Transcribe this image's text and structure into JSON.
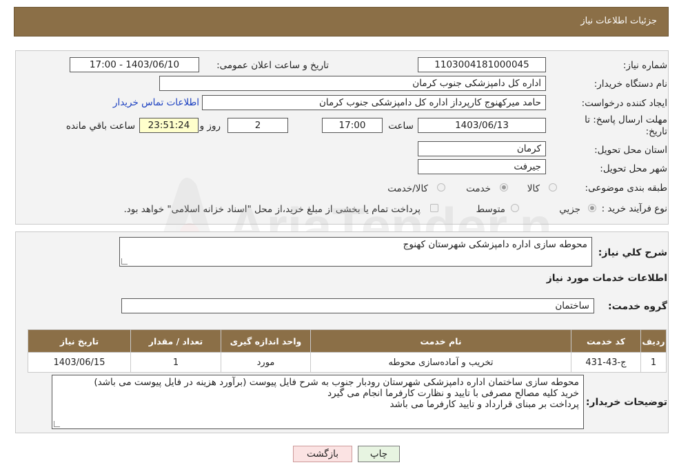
{
  "header": {
    "title": "جزئیات اطلاعات نیاز"
  },
  "form": {
    "need_number_label": "شماره نیاز:",
    "need_number": "1103004181000045",
    "announce_label": "تاریخ و ساعت اعلان عمومی:",
    "announce_value": "1403/06/10 - 17:00",
    "buyer_org_label": "نام دستگاه خریدار:",
    "buyer_org": "اداره کل دامپزشکی جنوب کرمان",
    "creator_label": "ایجاد کننده درخواست:",
    "creator": "حامد میرکهنوج کارپرداز اداره کل دامپزشکی جنوب کرمان",
    "contact_link": "اطلاعات تماس خریدار",
    "deadline_label_line1": "مهلت ارسال پاسخ: تا",
    "deadline_label_line2": "تاریخ:",
    "deadline_date": "1403/06/13",
    "time_label": "ساعت",
    "deadline_time": "17:00",
    "days_value": "2",
    "days_label": "روز و",
    "remaining_value": "23:51:24",
    "remaining_label": "ساعت باقي مانده",
    "province_label": "استان محل تحویل:",
    "province": "کرمان",
    "city_label": "شهر محل تحویل:",
    "city": "جیرفت",
    "category_label": "طبقه بندی موضوعی:",
    "category_options": [
      "کالا",
      "خدمت",
      "کالا/خدمت"
    ],
    "category_selected": "خدمت",
    "process_label": "نوع فرآیند خرید :",
    "process_options": [
      "جزیي",
      "متوسط"
    ],
    "process_note": "پرداخت تمام یا بخشی از مبلغ خرید،از محل \"اسناد خزانه اسلامی\" خواهد بود."
  },
  "details": {
    "summary_label": "شرح کلي نیاز:",
    "summary": "محوطه سازی اداره دامپزشکی شهرستان کهنوج",
    "services_heading": "اطلاعات خدمات مورد نیاز",
    "service_group_label": "گروه خدمت:",
    "service_group": "ساختمان",
    "table": {
      "headers": [
        "ردیف",
        "کد خدمت",
        "نام خدمت",
        "واحد اندازه گیری",
        "تعداد / مقدار",
        "تاریخ نیاز"
      ],
      "rows": [
        [
          "1",
          "ج-43-431",
          "تخریب و آماده‌سازی محوطه",
          "مورد",
          "1",
          "1403/06/15"
        ]
      ]
    },
    "buyer_notes_label": "توضیحات خریدار:",
    "buyer_notes_lines": [
      "محوطه سازی ساختمان اداره دامپزشکی شهرستان رودبار جنوب به شرح فایل پیوست (برآورد هزینه در فایل پیوست می باشد)",
      "خرید کلیه مصالح مصرفی با تایید و نظارت کارفرما انجام می گیرد",
      "پرداخت بر مبنای قرارداد و تایید کارفرما می باشد"
    ]
  },
  "buttons": {
    "print": "چاپ",
    "back": "بازگشت"
  },
  "watermark": {
    "text": "AriaTender.neT"
  },
  "colors": {
    "header_bg": "#8b6f47",
    "link": "#1a3fc0",
    "back_button_bg": "#fbe3e3",
    "print_button_bg": "#e7f4e1"
  }
}
